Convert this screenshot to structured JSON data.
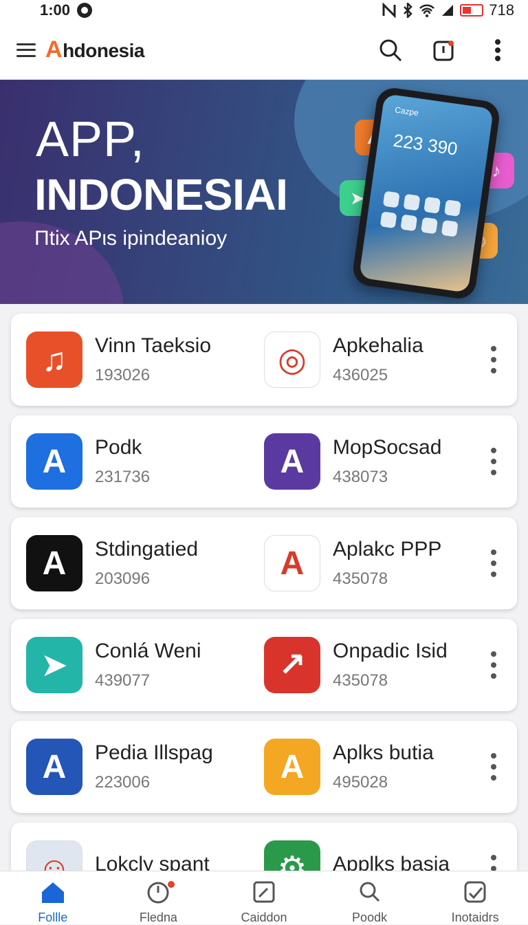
{
  "status_bar": {
    "time": "1:00",
    "battery": "718"
  },
  "app_bar": {
    "brand_mark": "A",
    "brand_rest": "hdonesia"
  },
  "hero": {
    "title_line1": "APP,",
    "title_line2": "INDONESIAI",
    "subtitle": "Πtix APιs ipindeanioy",
    "phone_clock": "223 390",
    "phone_label": "Cazpe"
  },
  "apps": [
    [
      {
        "name": "Vinn Taeksio",
        "count": "193026",
        "color": "#e8502a",
        "glyph": "♫",
        "icon": "music-app-icon"
      },
      {
        "name": "Apkehalia",
        "count": "436025",
        "color": "#ffffff",
        "glyph": "◎",
        "icon": "target-app-icon"
      }
    ],
    [
      {
        "name": "Podk",
        "count": "231736",
        "color": "#1e6fe0",
        "glyph": "A",
        "icon": "letter-a-app-icon"
      },
      {
        "name": "MopSocsad",
        "count": "438073",
        "color": "#5a3aa0",
        "glyph": "A",
        "icon": "letter-a-app-icon"
      }
    ],
    [
      {
        "name": "Stdingatied",
        "count": "203096",
        "color": "#111111",
        "glyph": "A",
        "icon": "letter-a-app-icon"
      },
      {
        "name": "Aplakc PPP",
        "count": "435078",
        "color": "#ffffff",
        "glyph": "A",
        "icon": "letter-a-app-icon"
      }
    ],
    [
      {
        "name": "Conlá Weni",
        "count": "439077",
        "color": "#22b5a8",
        "glyph": "➤",
        "icon": "arrow-app-icon"
      },
      {
        "name": "Onpadic Isid",
        "count": "435078",
        "color": "#d8342b",
        "glyph": "↗",
        "icon": "trending-app-icon"
      }
    ],
    [
      {
        "name": "Pedia Illspag",
        "count": "223006",
        "color": "#2456b8",
        "glyph": "A",
        "icon": "letter-a-app-icon"
      },
      {
        "name": "Aplks butia",
        "count": "495028",
        "color": "#f4a722",
        "glyph": "A",
        "icon": "letter-a-app-icon"
      }
    ],
    [
      {
        "name": "Lokcly spant",
        "count": "",
        "color": "#dfe6ef",
        "glyph": "☺",
        "icon": "person-photo-icon"
      },
      {
        "name": "Applks basia",
        "count": "",
        "color": "#2a9a4a",
        "glyph": "⚙",
        "icon": "gear-app-icon"
      }
    ]
  ],
  "bottom_nav": [
    {
      "label": "Follle",
      "icon": "home-icon",
      "active": true
    },
    {
      "label": "Fledna",
      "icon": "timer-icon",
      "active": false
    },
    {
      "label": "Caiddon",
      "icon": "edit-icon",
      "active": false
    },
    {
      "label": "Poodk",
      "icon": "search-icon",
      "active": false
    },
    {
      "label": "Inotaidrs",
      "icon": "check-icon",
      "active": false
    }
  ],
  "colors": {
    "accent": "#1a66d8",
    "brand": "#f26b2a",
    "hero_start": "#3a2f6e",
    "hero_end": "#3a6c98"
  }
}
